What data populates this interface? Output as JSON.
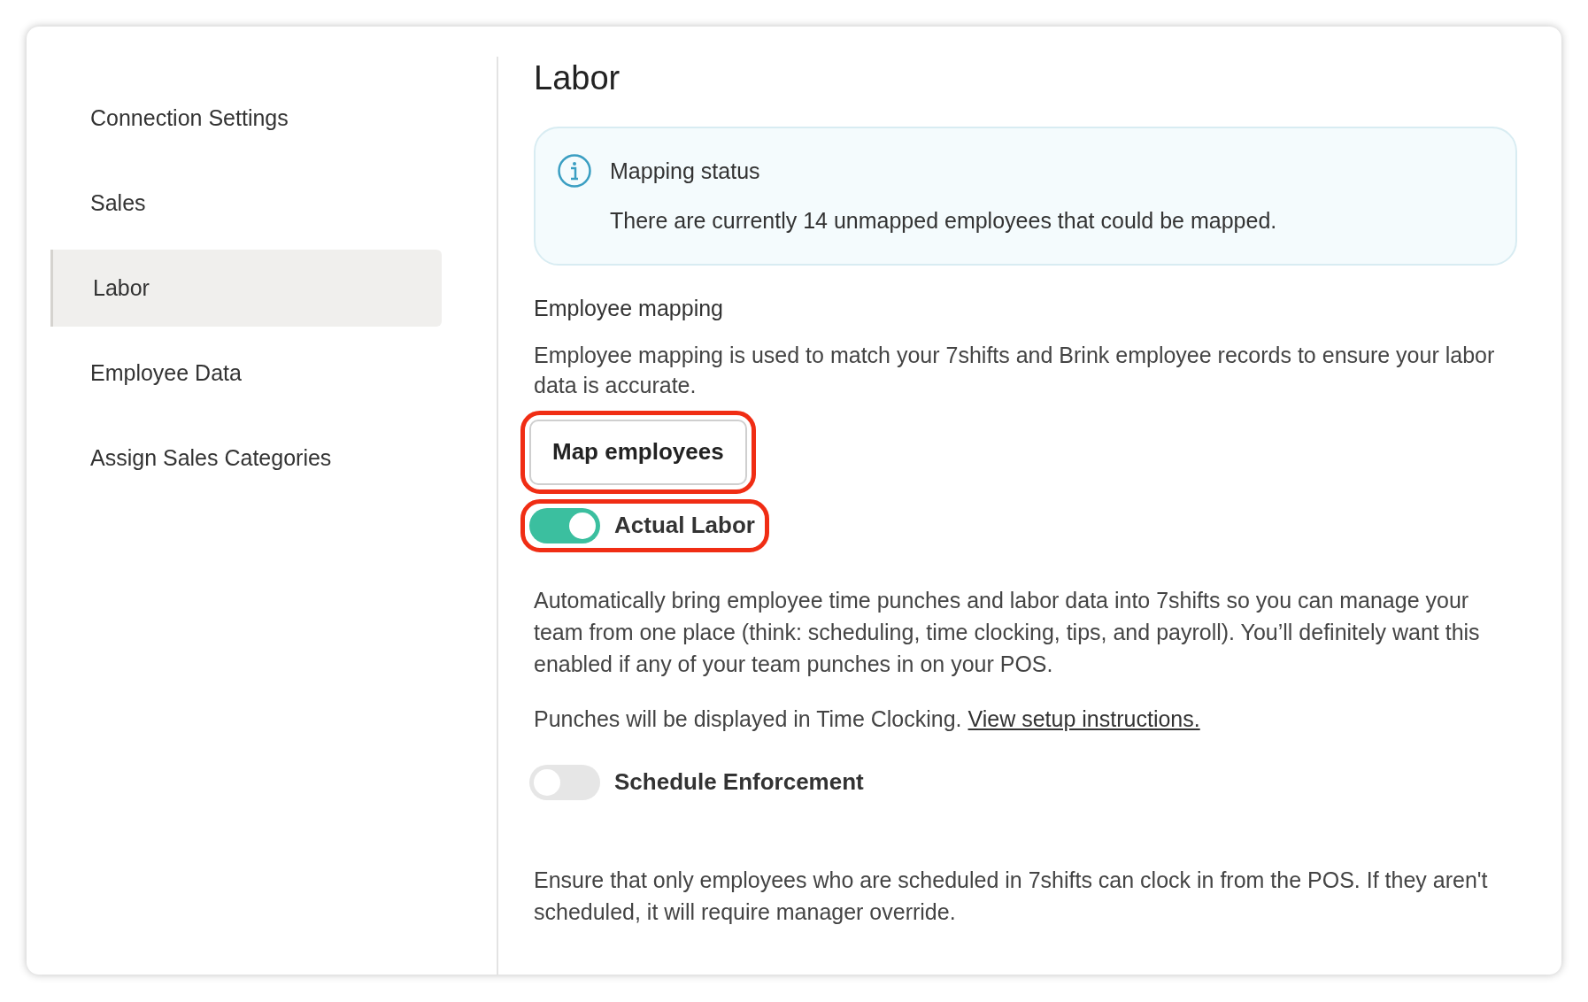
{
  "sidebar": {
    "items": [
      {
        "label": "Connection Settings",
        "selected": false
      },
      {
        "label": "Sales",
        "selected": false
      },
      {
        "label": "Labor",
        "selected": true
      },
      {
        "label": "Employee Data",
        "selected": false
      },
      {
        "label": "Assign Sales Categories",
        "selected": false
      }
    ]
  },
  "title": "Labor",
  "info": {
    "title": "Mapping status",
    "text": "There are currently 14 unmapped employees that could be mapped."
  },
  "mapping": {
    "heading": "Employee mapping",
    "text": "Employee mapping is used to match your 7shifts and Brink employee records to ensure your labor data is accurate.",
    "button": "Map employees",
    "highlighted": true
  },
  "toggles": [
    {
      "label": "Actual Labor",
      "on": true,
      "highlighted": true,
      "paragraphs": [
        {
          "text": "Automatically bring employee time punches and labor data into 7shifts so you can manage your team from one place (think: scheduling, time clocking, tips, and payroll). You’ll definitely want this enabled if any of your team punches in on your POS."
        },
        {
          "text": "Punches will be displayed in Time Clocking.",
          "link": "View setup instructions."
        }
      ]
    },
    {
      "label": "Schedule Enforcement",
      "on": false,
      "highlighted": false,
      "paragraphs": [
        {
          "text": "Ensure that only employees who are scheduled in 7shifts can clock in from the POS. If they aren't scheduled, it will require manager override."
        }
      ]
    }
  ]
}
